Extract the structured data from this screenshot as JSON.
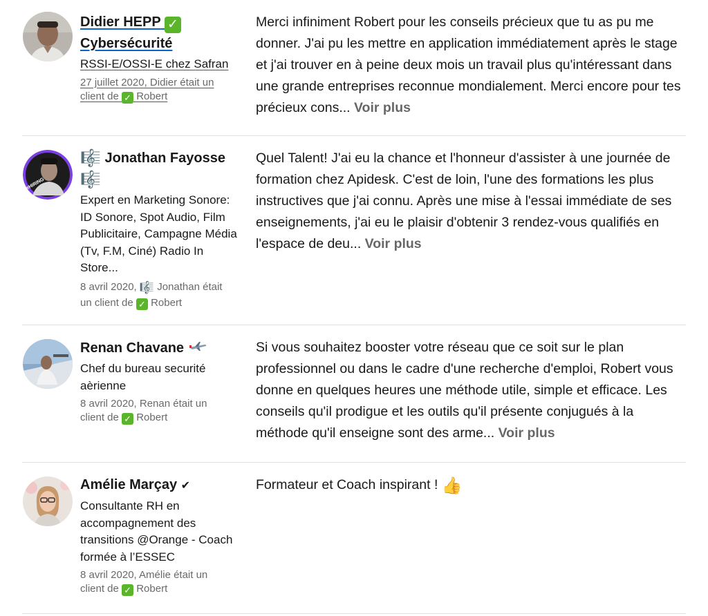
{
  "recommendations": [
    {
      "name": "Didier HEPP",
      "name_badge": "✅",
      "name_line2": "Cybersécurité",
      "headline": "RSSI-E/OSSI-E chez Safran",
      "meta_line1": "27 juillet 2020, Didier était un",
      "meta_line2_prefix": "client de",
      "meta_badge": "✅",
      "meta_line2_suffix": "Robert",
      "text": "Merci infiniment Robert pour les conseils précieux que tu as pu me donner. J'ai pu les mettre en application immédiatement après le stage et j'ai trouver en à peine deux mois un travail plus qu'intéressant dans une grande entreprises reconnue mondialement. Merci encore pour tes précieux cons...",
      "more_label": "Voir plus"
    },
    {
      "name_prefix_icon": "🎼",
      "name": "Jonathan Fayosse",
      "name_suffix_icon": "🎼",
      "headline": "Expert en Marketing Sonore: ID Sonore, Spot Audio, Film Publicitaire, Campagne Média (Tv, F.M, Ciné) Radio In Store...",
      "meta_line1_prefix": "8 avril 2020,",
      "meta_line1_icon": "🎼",
      "meta_line1_suffix": "Jonathan était",
      "meta_line2_prefix": "un client de",
      "meta_badge": "✅",
      "meta_line2_suffix": "Robert",
      "avatar_badge": "#HIRING",
      "text": "Quel Talent! J'ai eu la chance et l'honneur d'assister à une journée de formation chez Apidesk. C'est de loin, l'une des formations les plus instructives que j'ai connu. Après une mise à l'essai immédiate de ses enseignements, j'ai eu le plaisir d'obtenir 3 rendez-vous qualifiés en l'espace de deu...",
      "more_label": "Voir plus"
    },
    {
      "name": "Renan Chavane",
      "headline": "Chef du bureau securité aèrienne",
      "meta_line1": "8 avril 2020, Renan était un",
      "meta_line2_prefix": "client de",
      "meta_badge": "✅",
      "meta_line2_suffix": "Robert",
      "text": "Si vous souhaitez booster votre réseau que ce soit sur le plan professionnel ou dans le cadre d'une recherche d'emploi, Robert vous donne en quelques heures une méthode utile, simple et efficace. Les conseils qu'il prodigue et les outils qu'il présente conjugués à la méthode qu'il enseigne sont des arme...",
      "more_label": "Voir plus"
    },
    {
      "name": "Amélie Marçay",
      "name_badge": "✔",
      "headline": "Consultante RH en accompagnement des transitions @Orange - Coach formée à l’ESSEC",
      "meta_line1": "8 avril 2020, Amélie était un",
      "meta_line2_prefix": "client de",
      "meta_badge": "✅",
      "meta_line2_suffix": "Robert",
      "text": "Formateur et Coach inspirant !",
      "text_emoji": "👍"
    }
  ],
  "colors": {
    "link_underline": "#0a66c2",
    "check_badge": "#5ab52b",
    "divider": "#e0e0e0",
    "hiring_ring": "#7b3fe4"
  },
  "icons": [
    "check-badge-icon",
    "music-notes-icon",
    "airplane-icon",
    "checkmark-icon",
    "thumbs-up-icon"
  ]
}
